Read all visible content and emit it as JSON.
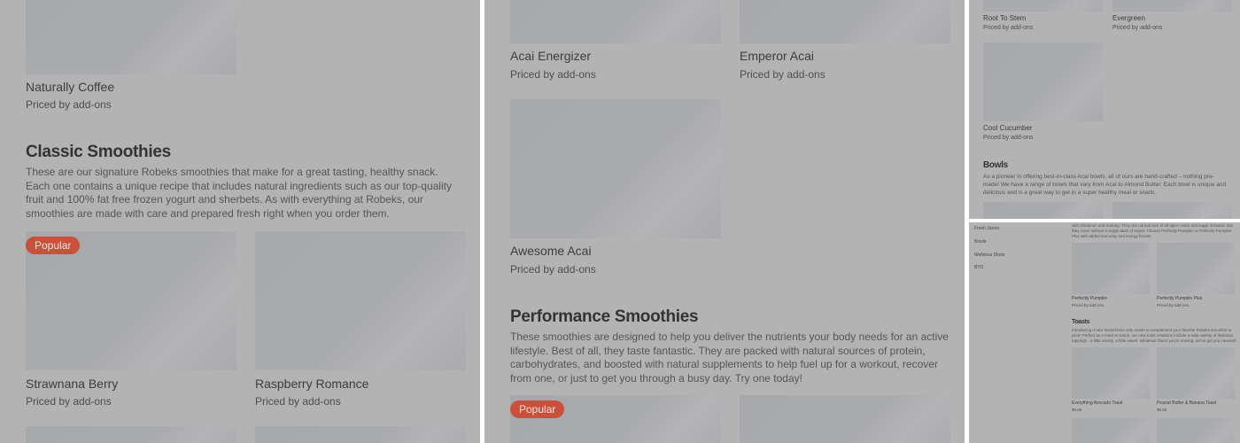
{
  "common": {
    "price_label": "Priced by add-ons",
    "popular_label": "Popular"
  },
  "panel1": {
    "items": [
      {
        "name": "Naturally Coffee"
      },
      {
        "name": "Strawnana Berry"
      },
      {
        "name": "Raspberry Romance"
      }
    ],
    "section": {
      "title": "Classic Smoothies",
      "description": "These are our signature Robeks smoothies that make for a great tasting, healthy snack. Each one contains a unique recipe that includes natural ingredients such as our top-quality fruit and 100% fat free frozen yogurt and sherbets. As with everything at Robeks, our smoothies are made with care and prepared fresh right when you order them."
    }
  },
  "panel2": {
    "items": [
      {
        "name": "Acai Energizer"
      },
      {
        "name": "Emperor Acai"
      },
      {
        "name": "Awesome Acai"
      }
    ],
    "section": {
      "title": "Performance Smoothies",
      "description": "These smoothies are designed to help you deliver the nutrients your body needs for an active lifestyle. Best of all, they taste fantastic. They are packed with natural sources of protein, carbohydrates, and boosted with natural supplements to help fuel up for a workout, recover from one, or just to get you through a busy day. Try one today!"
    }
  },
  "panel3": {
    "items": [
      {
        "name": "Root To Stem"
      },
      {
        "name": "Evergreen"
      },
      {
        "name": "Cool Cucumber"
      }
    ],
    "section": {
      "title": "Bowls",
      "description": "As a pioneer in offering best-in-class Acai bowls, all of ours are hand-crafted – nothing pre-made! We have a range of bowls that vary from Acai to Almond Butter. Each bowl is unique and delicious and is a great way to get in a super healthy meal or snack."
    }
  },
  "panel4": {
    "nav": [
      "Fresh Juices",
      "Bowls",
      "Wellness Shots",
      "BYO"
    ],
    "intro": "with cinnamon and nutmeg. They are normal size of all-spice notes and sugar included. But they come without a single dash of regret. Choose Perfectly Pumpkin or Perfectly Pumpkin Plus with added immunity and energy boosts.",
    "items": [
      {
        "name": "Perfectly Pumpkin"
      },
      {
        "name": "Perfectly Pumpkin Plus"
      }
    ],
    "section": {
      "title": "Toasts",
      "description": "Introducing 4 new limited-time only toasts to complement your favorite Robeks smoothie or juice! Perfect as a meal or snack, our new toast creations include a wide variety of delicious toppings - a little savory, a little sweet. Whatever flavor you're craving, we've got you covered!"
    },
    "toasts": [
      {
        "name": "Everything Avocado Toast",
        "price": "$9.65"
      },
      {
        "name": "Peanut Butter & Banana Toast",
        "price": "$8.65"
      }
    ]
  }
}
